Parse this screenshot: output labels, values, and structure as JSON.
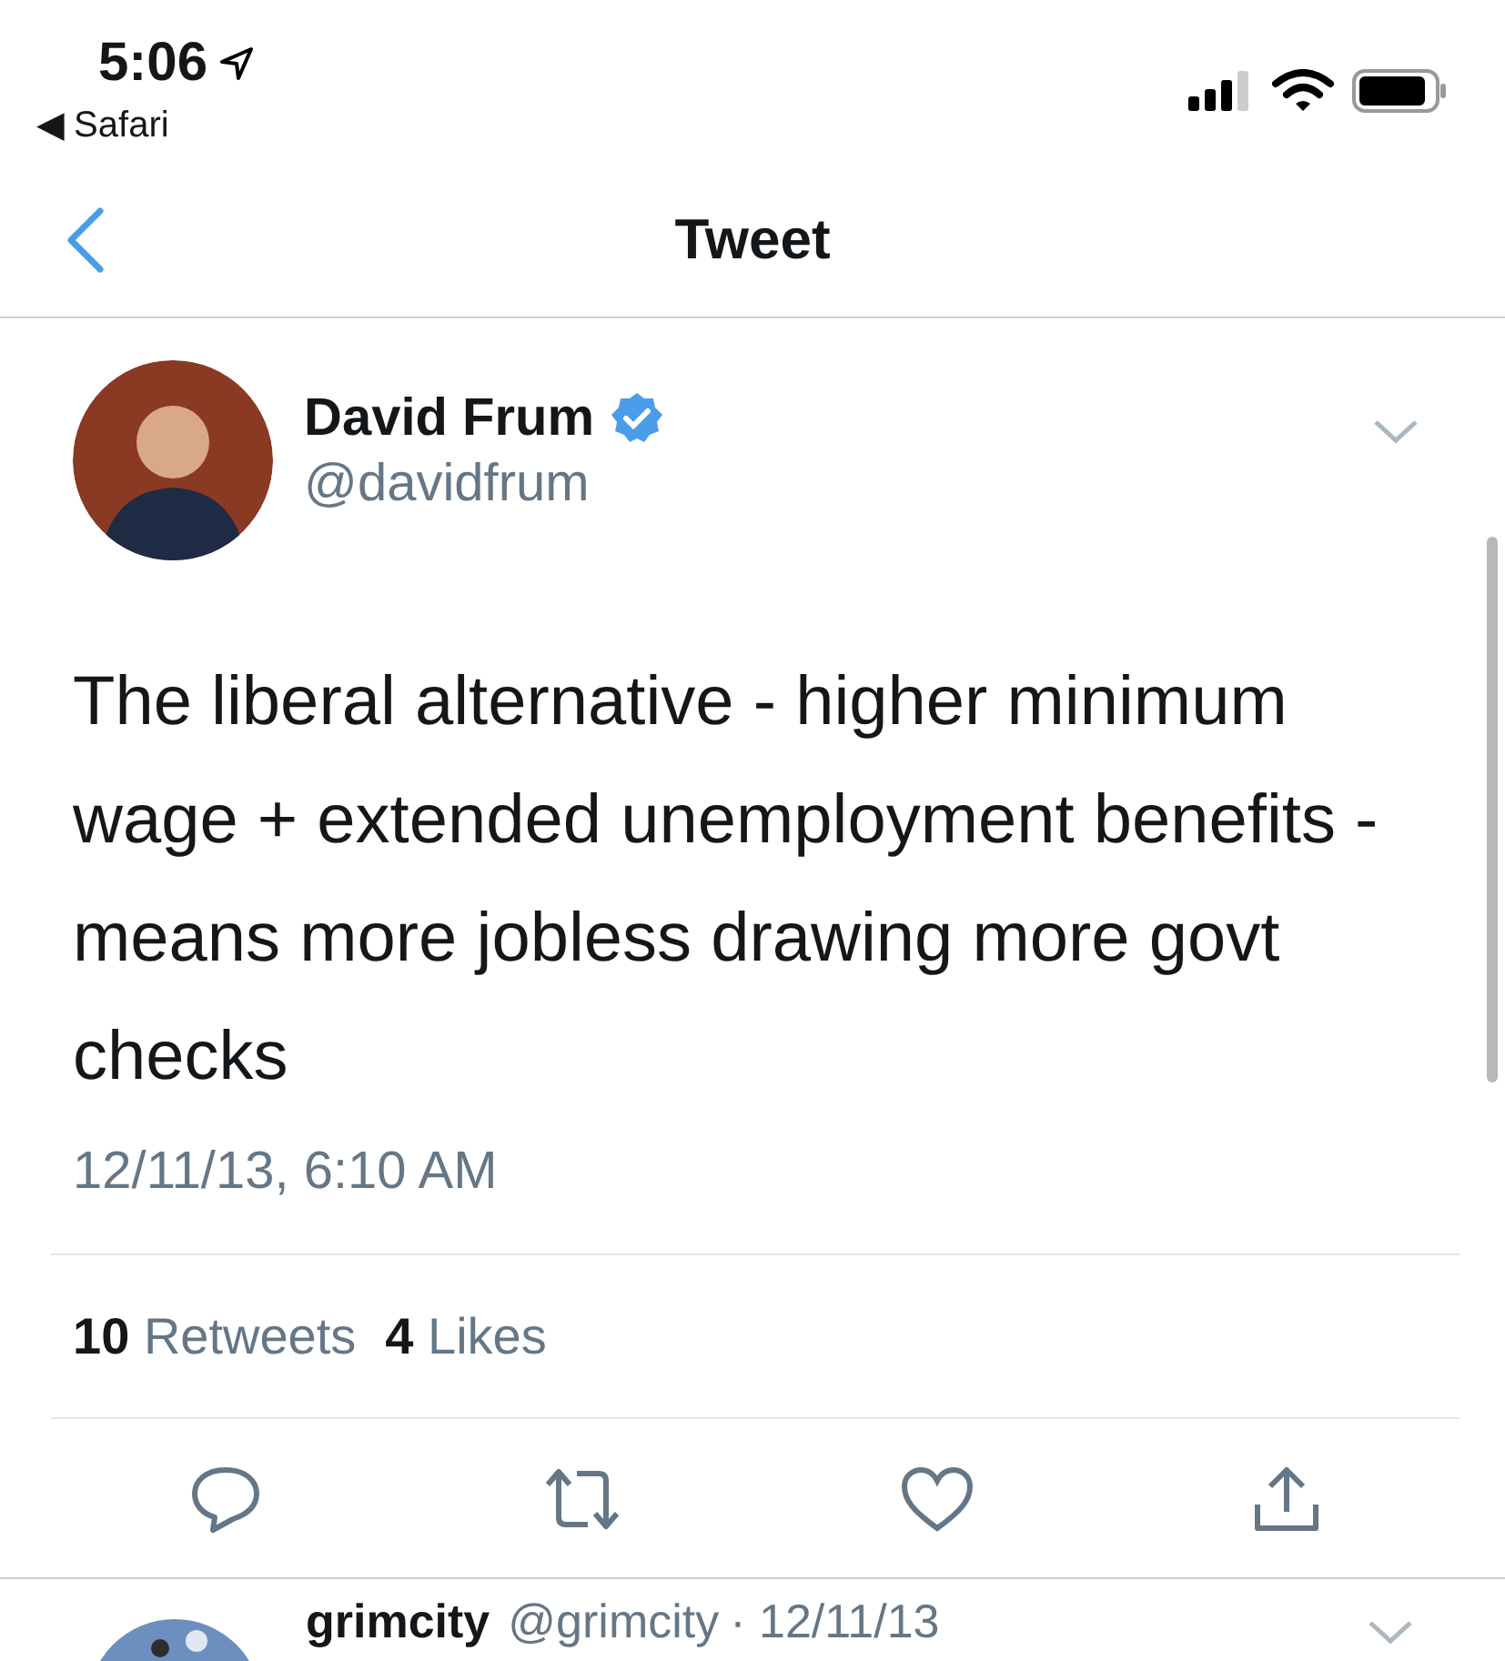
{
  "status_bar": {
    "time": "5:06",
    "back_app": "◀ Safari"
  },
  "nav": {
    "title": "Tweet"
  },
  "tweet": {
    "name": "David Frum",
    "verified": true,
    "handle": "@davidfrum",
    "text": "The liberal alternative - higher minimum wage + extended unemployment benefits - means more jobless drawing more govt checks",
    "timestamp": "12/11/13, 6:10 AM",
    "stats": [
      {
        "count": "10",
        "label": "Retweets"
      },
      {
        "count": "4",
        "label": "Likes"
      }
    ]
  },
  "reply": {
    "name": "grimcity",
    "handle": "@grimcity",
    "date": "· 12/11/13"
  }
}
